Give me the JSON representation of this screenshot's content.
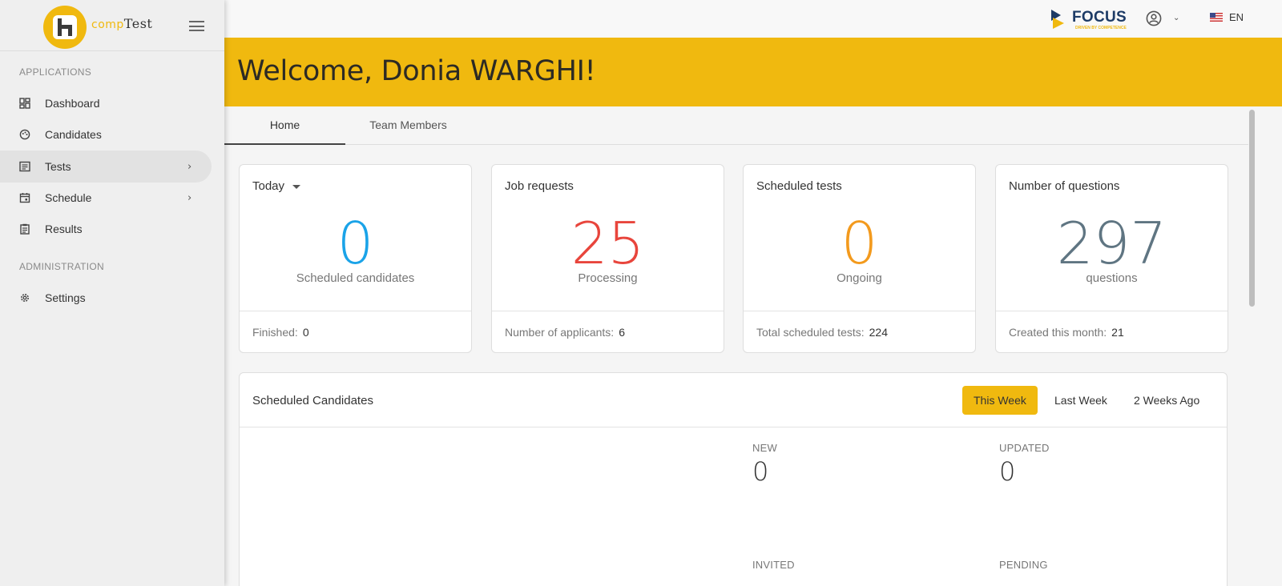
{
  "brand": {
    "logo_part1": "comp",
    "logo_part2": "Test"
  },
  "sidebar": {
    "sections": {
      "applications": "APPLICATIONS",
      "administration": "ADMINISTRATION"
    },
    "items": [
      {
        "label": "Dashboard",
        "icon": "dashboard-icon"
      },
      {
        "label": "Candidates",
        "icon": "candidates-icon"
      },
      {
        "label": "Tests",
        "icon": "tests-icon",
        "active": true,
        "has_submenu": true
      },
      {
        "label": "Schedule",
        "icon": "calendar-icon",
        "has_submenu": true
      },
      {
        "label": "Results",
        "icon": "clipboard-icon"
      },
      {
        "label": "Settings",
        "icon": "gear-icon"
      }
    ],
    "chevron": "›"
  },
  "topbar": {
    "partner_logo": "FOCUS",
    "partner_tagline": "DRIVEN BY COMPETENCE",
    "language": "EN",
    "user_chevron": "⌄"
  },
  "banner": {
    "title": "Welcome, Donia WARGHI!"
  },
  "tabs": [
    {
      "label": "Home",
      "active": true
    },
    {
      "label": "Team Members",
      "active": false
    }
  ],
  "cards": [
    {
      "title": "Today",
      "value": "0",
      "subtitle": "Scheduled candidates",
      "footer_label": "Finished:",
      "footer_value": "0",
      "color": "#1aa3e8"
    },
    {
      "title": "Job requests",
      "value": "25",
      "subtitle": "Processing",
      "footer_label": "Number of applicants:",
      "footer_value": "6",
      "color": "#e8453c"
    },
    {
      "title": "Scheduled tests",
      "value": "0",
      "subtitle": "Ongoing",
      "footer_label": "Total scheduled tests:",
      "footer_value": "224",
      "color": "#f39a1d"
    },
    {
      "title": "Number of questions",
      "value": "297",
      "subtitle": "questions",
      "footer_label": "Created this month:",
      "footer_value": "21",
      "color": "#5f7582"
    }
  ],
  "scheduled_candidates": {
    "title": "Scheduled Candidates",
    "ranges": [
      {
        "label": "This Week",
        "active": true
      },
      {
        "label": "Last Week",
        "active": false
      },
      {
        "label": "2 Weeks Ago",
        "active": false
      }
    ],
    "stats": [
      {
        "label": "NEW",
        "value": "0"
      },
      {
        "label": "UPDATED",
        "value": "0"
      },
      {
        "label": "INVITED",
        "value": ""
      },
      {
        "label": "PENDING",
        "value": ""
      }
    ]
  },
  "colors": {
    "accent": "#f0b90f",
    "brand_dark": "#1d3b66"
  }
}
